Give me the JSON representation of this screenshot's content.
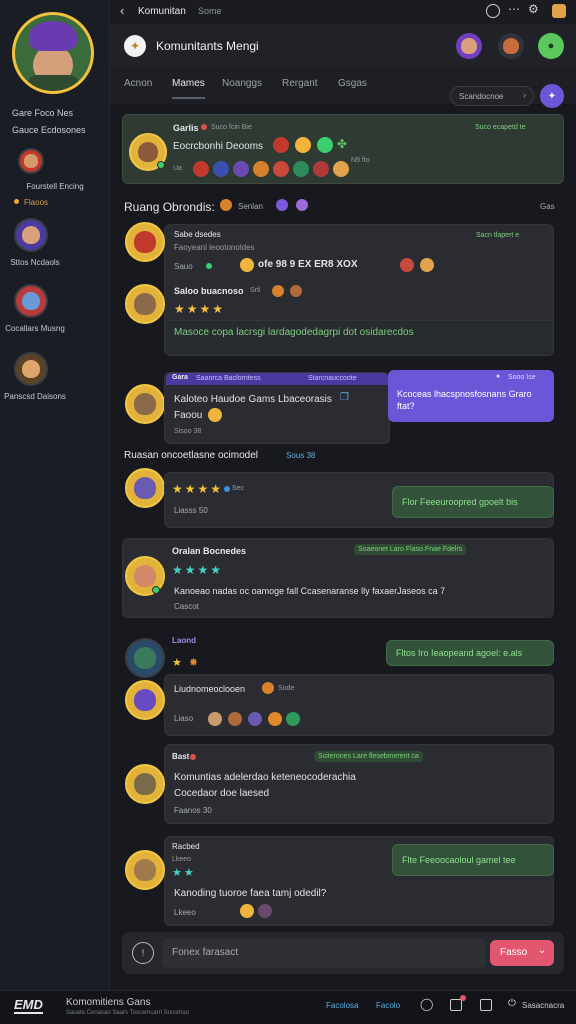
{
  "topbar": {
    "title": "Komunitan",
    "subtitle": "Some"
  },
  "header": {
    "title": "Komunitants Mengi"
  },
  "tabs": [
    "Acnon",
    "Mames",
    "Noanggs",
    "Rergant",
    "Gsgas"
  ],
  "search": {
    "placeholder": "Scandocnoe"
  },
  "sidebar": {
    "title": "Gare Foco Nes",
    "subtitle": "Gauce Ecdosones",
    "items": [
      {
        "label": "Fourstell Encing"
      },
      {
        "label": "Flaoos",
        "tag": true
      },
      {
        "label": "Sttos Ncdaols"
      },
      {
        "label": "Cocallars Musng"
      },
      {
        "label": "Panscsd Daisons"
      }
    ]
  },
  "pinned": {
    "name": "Garlis",
    "meta": "Suco fcin Bie",
    "tag": "Suco ecapetd te",
    "msg": "Eocrcbonhi Deooms",
    "sub": "Ua",
    "badge": "N9 fto"
  },
  "section1": {
    "title": "Ruang Obrondis:",
    "sub": "Senlan",
    "right": "Gas"
  },
  "m1": {
    "name": "Sabe dsedes",
    "meta": "Faoyeanl leootonoldes",
    "tag": "Sacn tlapert e",
    "msg": "Sauo",
    "line": "ofe 98 9 EX ER8 XOX"
  },
  "m2": {
    "name": "Saloo buacnoso",
    "meta": "Srtl",
    "msg": "Masoce copa lacrsgi lardagodedagrpi dot osidarecdos"
  },
  "m3": {
    "name": "Gara",
    "tag": "Saanrca Baclorntess",
    "tag2": "Starcnauccoote",
    "msg": "Kaloteo Haudoe Gams Lbaceorasis",
    "sub": "Faoou",
    "meta": "Sisoo 38",
    "purple": "Kcoceas lhacspnosfosnans Graro ftat?",
    "ptag": "Sooo Ise"
  },
  "section2": {
    "title": "Ruasan oncoetlasne ocimodel",
    "tag": "Sous 38"
  },
  "m4": {
    "meta": "Sec",
    "sub": "Liasss 50",
    "green": "Flor Feeeuroopred gpoelt bis"
  },
  "m5": {
    "name": "Oralan Bocnedes",
    "tag": "Soaeonet Laro Flaso Fnae Fdelrs",
    "msg": "Kanoeao nadas oc oamoge fall Ccasenaranse lly faxaerJaseos ca 7",
    "sub": "Cascot"
  },
  "m6": {
    "name": "Laond",
    "green": "Fltos Iro Ieaopeand agoel: e.als",
    "name2": "Liudnomeoclooen",
    "meta2": "Sode",
    "sub": "Liaso"
  },
  "m7": {
    "name": "Bast",
    "tag": "Sciterones Lare flesebmerent ca",
    "msg": "Komuntias adelerdao keteneocoderachia",
    "msg2": "Cocedaor doe laesed",
    "sub": "Faanos 30"
  },
  "m8": {
    "name": "Racbed",
    "sub": "Lkeeo",
    "msg": "Kanoding tuoroe faea tamj odedil?",
    "green": "Flte Feeoocaoloul gamel tee"
  },
  "input": {
    "placeholder": "Fonex farasact",
    "send": "Fasso"
  },
  "footer": {
    "logo": "EMD",
    "title": "Komomitiens Gans",
    "sub": "Sauate Cenasan Saars Toxcemcarrl Sonstrioo",
    "links": [
      "Facolosa",
      "Facolo"
    ],
    "right": "Sasacnacra"
  },
  "colors": {
    "accent": "#6d55d8",
    "green": "#3ccf6d",
    "send": "#e25670"
  }
}
